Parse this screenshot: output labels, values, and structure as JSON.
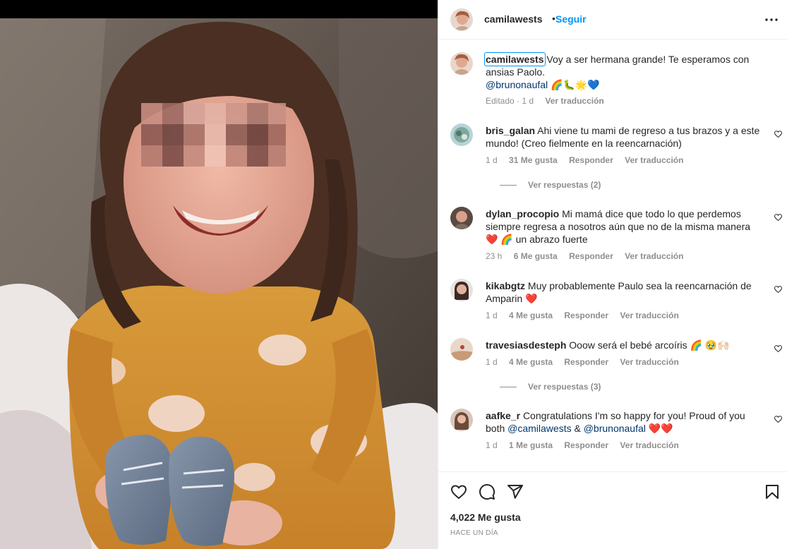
{
  "post": {
    "username": "camilawests",
    "follow_label": "Seguir",
    "separator": "•",
    "likes": "4,022 Me gusta",
    "time_ago": "HACE UN DÍA"
  },
  "caption": {
    "username": "camilawests",
    "text": "Voy a ser hermana grande! Te esperamos con ansias Paolo.",
    "mention": "@brunonaufal",
    "emojis": "🌈🐛🌟💙",
    "edited": "Editado · 1 d",
    "translate": "Ver traducción"
  },
  "comments": [
    {
      "user": "bris_galan",
      "text": "Ahi viene tu mami de regreso a tus brazos y a este mundo! (Creo fielmente en la reencarnación)",
      "time": "1 d",
      "likes": "31 Me gusta",
      "reply": "Responder",
      "translate": "Ver traducción",
      "view_replies": "Ver respuestas (2)"
    },
    {
      "user": "dylan_procopio",
      "text": "Mi mamá dice que todo lo que perdemos siempre regresa a nosotros aún que no de la misma manera",
      "text_end": "❤️ 🌈 un abrazo fuerte",
      "time": "23 h",
      "likes": "6 Me gusta",
      "reply": "Responder",
      "translate": "Ver traducción"
    },
    {
      "user": "kikabgtz",
      "text": "Muy probablemente Paulo sea la reencarnación de Amparin ❤️",
      "time": "1 d",
      "likes": "4 Me gusta",
      "reply": "Responder",
      "translate": "Ver traducción"
    },
    {
      "user": "travesiasdesteph",
      "text": "Ooow será el bebé arcoíris 🌈 🥹🙌🏻",
      "time": "1 d",
      "likes": "4 Me gusta",
      "reply": "Responder",
      "translate": "Ver traducción",
      "view_replies": "Ver respuestas (3)"
    },
    {
      "user": "aafke_r",
      "text": "Congratulations I'm so happy for you! Proud of you both",
      "mention1": "@camilawests",
      "amp": "&",
      "mention2": "@brunonaufal",
      "emojis": "❤️❤️",
      "time": "1 d",
      "likes": "1 Me gusta",
      "reply": "Responder",
      "translate": "Ver traducción"
    }
  ],
  "icons": {
    "more": "more-options-icon",
    "like": "heart-icon",
    "comment": "comment-icon",
    "share": "send-icon",
    "save": "bookmark-icon"
  },
  "colors": {
    "accent": "#0095f6",
    "mention": "#00376b",
    "muted": "#8e8e8e",
    "text": "#262626"
  }
}
